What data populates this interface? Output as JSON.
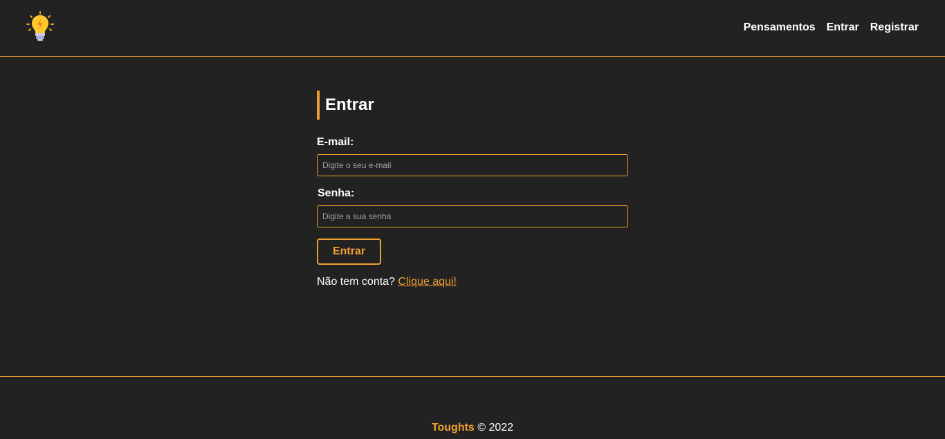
{
  "nav": {
    "logo_icon": "lightbulb-icon",
    "links": [
      "Pensamentos",
      "Entrar",
      "Registrar"
    ]
  },
  "login": {
    "title": "Entrar",
    "email_label": "E-mail:",
    "email_placeholder": "Digite o seu e-mail",
    "email_value": "",
    "password_label": "Senha:",
    "password_placeholder": "Digite a sua senha",
    "password_value": "",
    "submit_label": "Entrar",
    "no_account_text": "Não tem conta?",
    "register_link_text": "Clique aqui!"
  },
  "footer": {
    "brand": "Toughts",
    "copyright": "© 2022"
  },
  "colors": {
    "background": "#222222",
    "accent": "#f0a030",
    "text": "#ffffff",
    "placeholder": "#a0a0a0"
  }
}
